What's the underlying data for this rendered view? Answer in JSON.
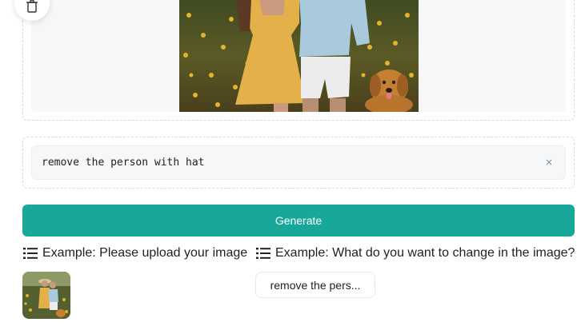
{
  "upload": {
    "photo_alt": "uploaded photo"
  },
  "prompt": {
    "value": "remove the person with hat",
    "clear_symbol": "×"
  },
  "generate": {
    "label": "Generate",
    "color": "#17a89a"
  },
  "examples": {
    "image_header": "Example: Please upload your image",
    "prompt_header": "Example: What do you want to change in the image?",
    "prompt_chip": "remove the pers..."
  }
}
